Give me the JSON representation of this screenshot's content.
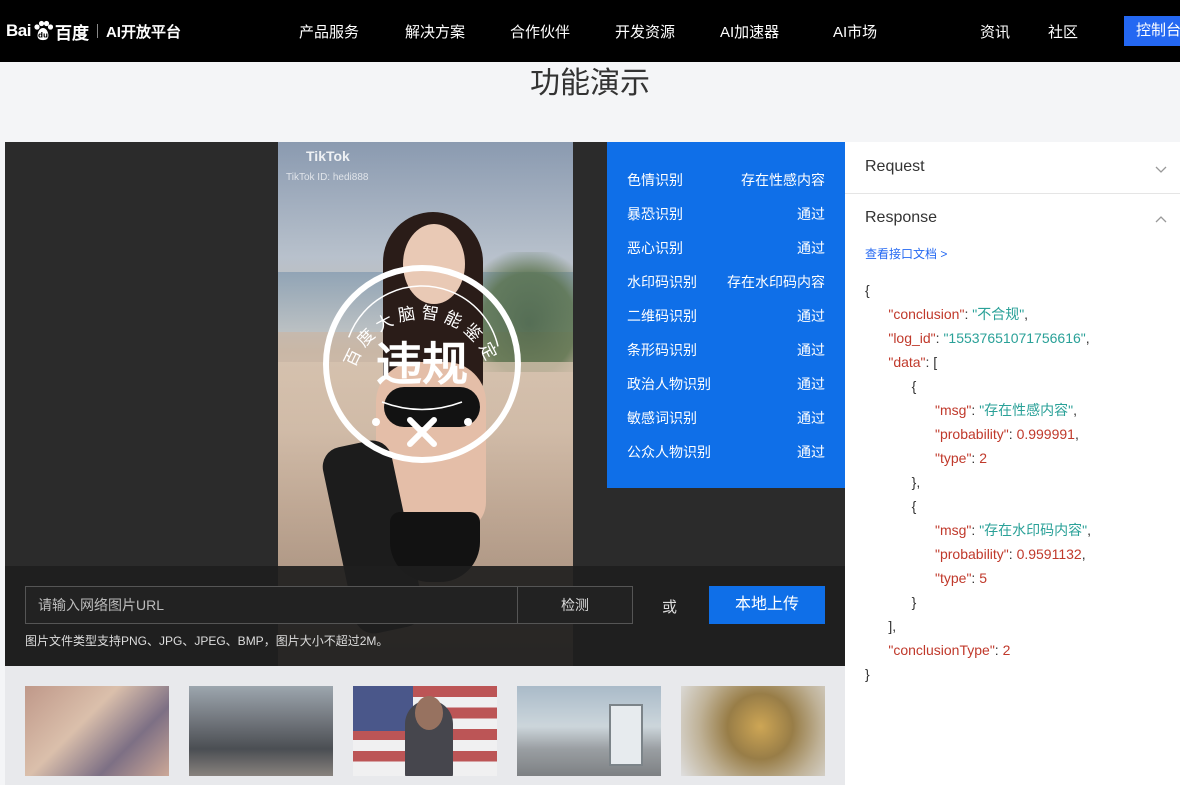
{
  "nav": {
    "logo_bai": "Bai",
    "logo_du": "百度",
    "logo_platform": "AI开放平台",
    "items": [
      "产品服务",
      "解决方案",
      "合作伙伴",
      "开发资源",
      "AI加速器",
      "AI市场"
    ],
    "right_items": [
      "资讯",
      "社区"
    ],
    "console": "控制台"
  },
  "demo_title": "功能演示",
  "image": {
    "watermark": "TikTok",
    "watermark_id": "TikTok ID: hedi888"
  },
  "seal": {
    "arc_text": "百度大脑智能鉴定",
    "verdict": "违规"
  },
  "results": [
    {
      "label": "色情识别",
      "value": "存在性感内容"
    },
    {
      "label": "暴恐识别",
      "value": "通过"
    },
    {
      "label": "恶心识别",
      "value": "通过"
    },
    {
      "label": "水印码识别",
      "value": "存在水印码内容"
    },
    {
      "label": "二维码识别",
      "value": "通过"
    },
    {
      "label": "条形码识别",
      "value": "通过"
    },
    {
      "label": "政治人物识别",
      "value": "通过"
    },
    {
      "label": "敏感词识别",
      "value": "通过"
    },
    {
      "label": "公众人物识别",
      "value": "通过"
    }
  ],
  "controls": {
    "url_placeholder": "请输入网络图片URL",
    "detect": "检测",
    "or": "或",
    "upload": "本地上传",
    "hint": "图片文件类型支持PNG、JPG、JPEG、BMP，图片大小不超过2M。"
  },
  "side": {
    "request": "Request",
    "response": "Response",
    "doc_link": "查看接口文档 >"
  },
  "response_json": {
    "conclusion_key": "\"conclusion\"",
    "conclusion_val": "\"不合规\"",
    "log_id_key": "\"log_id\"",
    "log_id_val": "\"15537651071756616\"",
    "data_key": "\"data\"",
    "msg_key": "\"msg\"",
    "probability_key": "\"probability\"",
    "type_key": "\"type\"",
    "item1_msg": "\"存在性感内容\"",
    "item1_prob": "0.999991",
    "item1_type": "2",
    "item2_msg": "\"存在水印码内容\"",
    "item2_prob": "0.9591132",
    "item2_type": "5",
    "conclusion_type_key": "\"conclusionType\"",
    "conclusion_type_val": "2"
  },
  "colors": {
    "nav_bg": "#000000",
    "accent": "#2468f2",
    "result_bg": "#0f6fe8"
  }
}
